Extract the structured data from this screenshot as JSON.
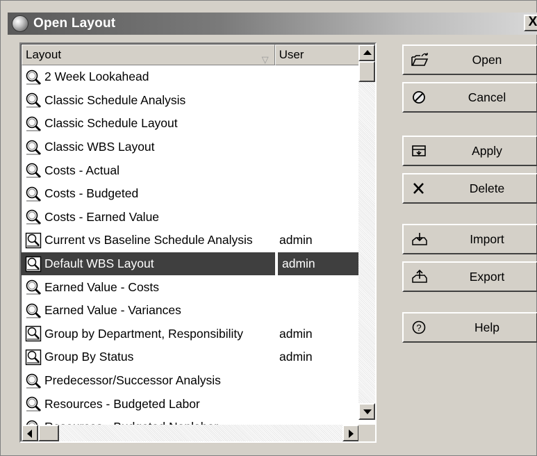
{
  "window": {
    "title": "Open Layout",
    "close_label": "X"
  },
  "columns": {
    "layout": "Layout",
    "user": "User"
  },
  "rows": [
    {
      "name": "2 Week Lookahead",
      "user": "",
      "icon": "magnifier-icon"
    },
    {
      "name": "Classic Schedule Analysis",
      "user": "",
      "icon": "magnifier-icon"
    },
    {
      "name": "Classic Schedule Layout",
      "user": "",
      "icon": "magnifier-icon"
    },
    {
      "name": "Classic WBS Layout",
      "user": "",
      "icon": "magnifier-icon"
    },
    {
      "name": "Costs - Actual",
      "user": "",
      "icon": "magnifier-icon"
    },
    {
      "name": "Costs - Budgeted",
      "user": "",
      "icon": "magnifier-icon"
    },
    {
      "name": "Costs - Earned Value",
      "user": "",
      "icon": "magnifier-icon"
    },
    {
      "name": "Current vs Baseline Schedule Analysis",
      "user": "admin",
      "icon": "user-layout-icon"
    },
    {
      "name": "Default WBS Layout",
      "user": "admin",
      "icon": "user-layout-icon",
      "selected": true
    },
    {
      "name": "Earned Value - Costs",
      "user": "",
      "icon": "magnifier-icon"
    },
    {
      "name": "Earned Value - Variances",
      "user": "",
      "icon": "magnifier-icon"
    },
    {
      "name": "Group by Department, Responsibility",
      "user": "admin",
      "icon": "user-layout-icon"
    },
    {
      "name": "Group By Status",
      "user": "admin",
      "icon": "user-layout-icon"
    },
    {
      "name": "Predecessor/Successor Analysis",
      "user": "",
      "icon": "magnifier-icon"
    },
    {
      "name": "Resources - Budgeted Labor",
      "user": "",
      "icon": "magnifier-icon"
    },
    {
      "name": "Resources - Budgeted Nonlabor",
      "user": "",
      "icon": "magnifier-icon"
    }
  ],
  "buttons": {
    "open": "Open",
    "cancel": "Cancel",
    "apply": "Apply",
    "delete": "Delete",
    "import": "Import",
    "export": "Export",
    "help": "Help"
  },
  "colors": {
    "selection": "#3f3f3f",
    "dialog_bg": "#d4d0c8"
  }
}
